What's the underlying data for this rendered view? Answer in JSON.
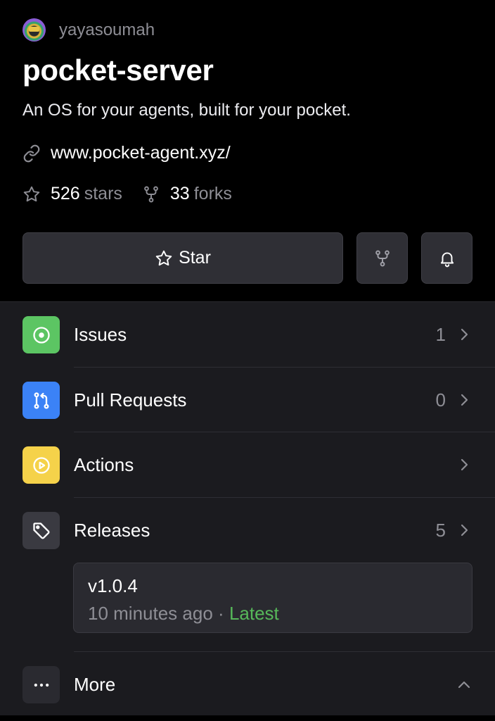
{
  "repo": {
    "owner": "yayasoumah",
    "name": "pocket-server",
    "description": "An OS for your agents, built for your pocket.",
    "website": "www.pocket-agent.xyz/",
    "stars_count": "526",
    "stars_label": "stars",
    "forks_count": "33",
    "forks_label": "forks"
  },
  "actions": {
    "star_label": "Star"
  },
  "sections": {
    "issues": {
      "label": "Issues",
      "count": "1",
      "color": "#5cc563"
    },
    "pull_requests": {
      "label": "Pull Requests",
      "count": "0",
      "color": "#3b82f6"
    },
    "actions": {
      "label": "Actions",
      "color": "#f5d24a"
    },
    "releases": {
      "label": "Releases",
      "count": "5",
      "color": "#3a3a41"
    },
    "more": {
      "label": "More",
      "color": "#2a2a30"
    }
  },
  "latest_release": {
    "version": "v1.0.4",
    "time": "10 minutes ago",
    "separator": "·",
    "badge": "Latest"
  },
  "icons": [
    "avatar",
    "link-icon",
    "star-icon",
    "fork-icon",
    "bell-icon",
    "issue-icon",
    "pull-request-icon",
    "play-icon",
    "tag-icon",
    "ellipsis-icon",
    "chevron-right-icon",
    "chevron-up-icon"
  ]
}
